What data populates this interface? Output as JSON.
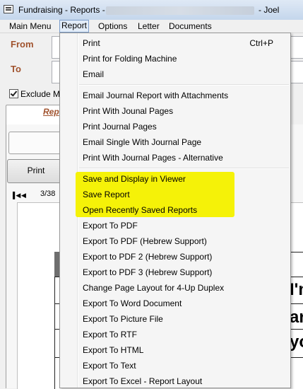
{
  "window": {
    "title": "Fundraising - Reports -",
    "user_suffix": "- Joel"
  },
  "menubar": {
    "items": [
      "Main Menu",
      "Report",
      "Options",
      "Letter",
      "Documents"
    ]
  },
  "form": {
    "from_label": "From",
    "to_label": "To",
    "exclude_label": "Exclude M",
    "tab_label": "Rep",
    "print_button": "Print",
    "page_indicator": "3/38",
    "report_fragments": [
      "I'm",
      "ar",
      "yo"
    ]
  },
  "report_menu": {
    "items": [
      {
        "label": "Print",
        "shortcut": "Ctrl+P"
      },
      {
        "label": "Print for Folding Machine"
      },
      {
        "label": "Email"
      },
      {
        "label": "Email Journal Report with Attachments"
      },
      {
        "label": "Print With Jounal Pages"
      },
      {
        "label": "Print Journal Pages"
      },
      {
        "label": "Email Single With Journal Page"
      },
      {
        "label": "Print With Journal Pages - Alternative"
      },
      {
        "label": "Save and Display in Viewer",
        "highlighted": true
      },
      {
        "label": "Save Report",
        "highlighted": true
      },
      {
        "label": "Open Recently Saved Reports",
        "highlighted": true
      },
      {
        "label": "Export To PDF"
      },
      {
        "label": "Export To PDF (Hebrew Support)"
      },
      {
        "label": "Export to PDF 2 (Hebrew Support)"
      },
      {
        "label": "Export to PDF 3 (Hebrew Support)"
      },
      {
        "label": "Change Page Layout for 4-Up Duplex"
      },
      {
        "label": "Export To Word Document"
      },
      {
        "label": "Export To Picture File"
      },
      {
        "label": "Export To RTF"
      },
      {
        "label": "Export To HTML"
      },
      {
        "label": "Export To Text"
      },
      {
        "label": "Export To Excel - Report Layout"
      }
    ]
  },
  "colors": {
    "highlight": "#f5f208",
    "label_accent": "#a0522d",
    "menu_active_border": "#7d9ecb"
  }
}
